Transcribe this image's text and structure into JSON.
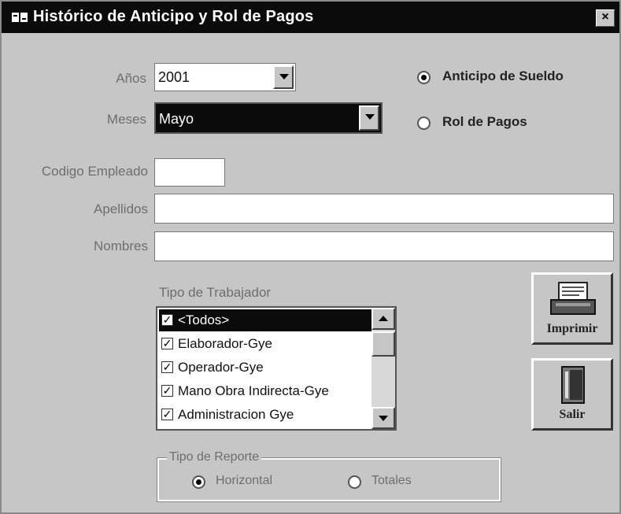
{
  "window": {
    "title": "Histórico de Anticipo y Rol de Pagos",
    "close_label": "×"
  },
  "form": {
    "anos_label": "Años",
    "anos_value": "2001",
    "meses_label": "Meses",
    "meses_value": "Mayo",
    "codigo_label": "Codigo Empleado",
    "codigo_value": "",
    "apellidos_label": "Apellidos",
    "apellidos_value": "",
    "nombres_label": "Nombres",
    "nombres_value": ""
  },
  "report_kind": {
    "options": [
      {
        "label": "Anticipo de Sueldo",
        "selected": true
      },
      {
        "label": "Rol de Pagos",
        "selected": false
      }
    ]
  },
  "tipo_trabajador": {
    "label": "Tipo de Trabajador",
    "items": [
      {
        "label": "<Todos>",
        "checked": true,
        "selected": true
      },
      {
        "label": "Elaborador-Gye",
        "checked": true,
        "selected": false
      },
      {
        "label": "Operador-Gye",
        "checked": true,
        "selected": false
      },
      {
        "label": "Mano Obra Indirecta-Gye",
        "checked": true,
        "selected": false
      },
      {
        "label": "Administracion Gye",
        "checked": true,
        "selected": false
      }
    ]
  },
  "buttons": {
    "imprimir": "Imprimir",
    "salir": "Salir"
  },
  "tipo_reporte": {
    "label": "Tipo de Reporte",
    "options": [
      {
        "label": "Horizontal",
        "selected": true
      },
      {
        "label": "Totales",
        "selected": false
      }
    ]
  }
}
